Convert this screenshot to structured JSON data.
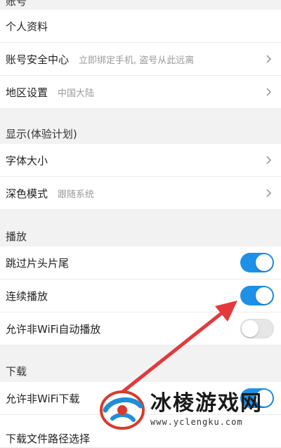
{
  "account": {
    "header": "账号",
    "items": [
      {
        "label": "个人资料",
        "sub": ""
      },
      {
        "label": "账号安全中心",
        "sub": "立即绑定手机, 盗号从此远离"
      },
      {
        "label": "地区设置",
        "sub": "中国大陆"
      }
    ]
  },
  "display": {
    "header": "显示(体验计划)",
    "items": [
      {
        "label": "字体大小",
        "sub": ""
      },
      {
        "label": "深色模式",
        "sub": "跟随系统"
      }
    ]
  },
  "playback": {
    "header": "播放",
    "items": [
      {
        "label": "跳过片头片尾",
        "toggle": true
      },
      {
        "label": "连续播放",
        "toggle": true
      },
      {
        "label": "允许非WiFi自动播放",
        "toggle": false
      }
    ]
  },
  "download": {
    "header": "下载",
    "items": [
      {
        "label": "允许非WiFi下载",
        "toggle": true
      },
      {
        "label": "下载文件路径选择"
      }
    ]
  },
  "watermark": {
    "title": "冰棱游戏网",
    "url": "www.yclengku.com"
  },
  "colors": {
    "toggle_on": "#1e90e8",
    "arrow": "#e5383b"
  }
}
